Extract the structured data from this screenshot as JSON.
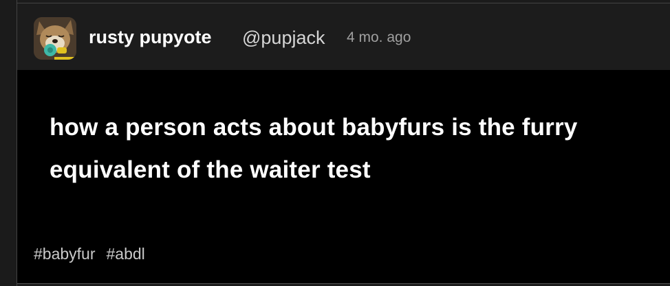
{
  "post": {
    "author": {
      "display_name": "rusty pupyote",
      "handle": "@pupjack",
      "avatar_icon": "coyote-with-pacifier-avatar"
    },
    "timestamp": "4 mo. ago",
    "body_line_1": "how a person acts about babyfurs is the furry",
    "body_line_2": "equivalent of the waiter test",
    "tags": [
      "#babyfur",
      "#abdl"
    ]
  },
  "colors": {
    "header_bg": "#1c1c1c",
    "body_bg": "#000000",
    "text_primary": "#ffffff",
    "text_secondary": "#a0a0a0",
    "tag_color": "#c9c9c9"
  }
}
